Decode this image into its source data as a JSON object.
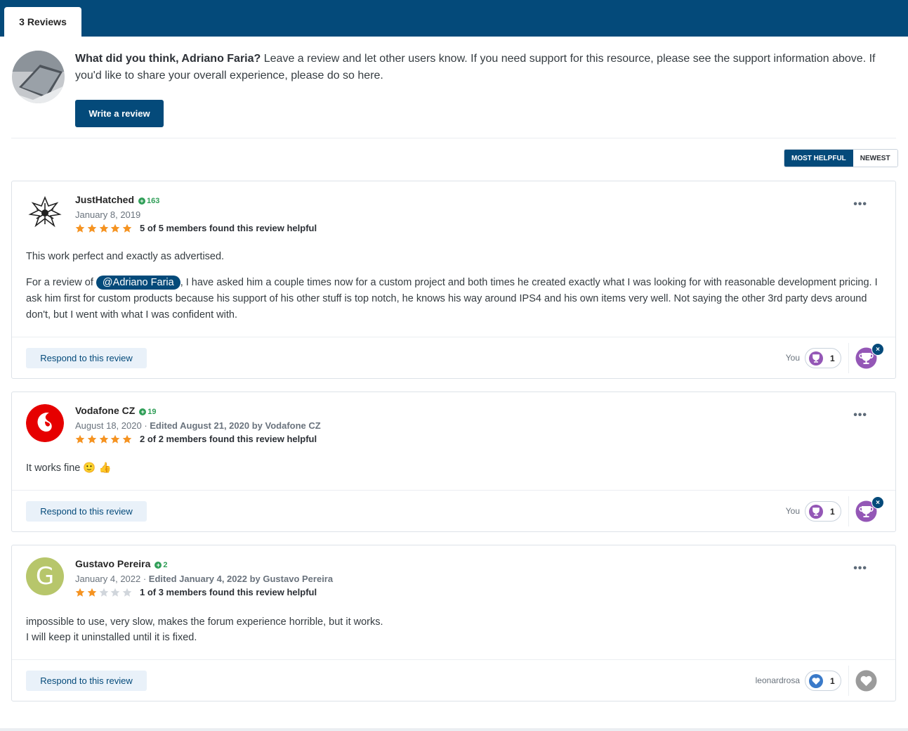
{
  "tabs": {
    "reviews_label": "3 Reviews"
  },
  "prompt": {
    "question": "What did you think, Adriano Faria?",
    "text": " Leave a review and let other users know. If you need support for this resource, please see the support information above. If you'd like to share your overall experience, please do so here.",
    "write_button": "Write a review"
  },
  "sort": {
    "most_helpful": "Most Helpful",
    "newest": "Newest"
  },
  "colors": {
    "brand": "#044a7a",
    "star": "#f59321",
    "rep": "#2f9e57",
    "trophy": "#9457b6",
    "like": "#3a7ac9"
  },
  "reviews": [
    {
      "author": "JustHatched",
      "rep": "163",
      "date": "January 8, 2019",
      "edited": "",
      "rating": 5,
      "helpful": "5 of 5 members found this review helpful",
      "paragraph1": "This work perfect and exactly as advertised.",
      "para2_prefix": "For a review of ",
      "mention": "@Adriano Faria",
      "para2_suffix": ", I have asked him a couple times now for a custom project and both times he created exactly what I was looking for with reasonable development pricing. I ask him first for custom products because his support of his other stuff is top notch, he knows his way around IPS4 and his own items very well. Not saying the other 3rd party devs around don't, but I went with what I was confident with.",
      "respond": "Respond to this review",
      "reacted_by": "You",
      "reaction_count": "1",
      "reaction_icon": "trophy-icon"
    },
    {
      "author": "Vodafone CZ",
      "rep": "19",
      "date": "August 18, 2020",
      "edited": "Edited August 21, 2020 by Vodafone CZ",
      "rating": 5,
      "helpful": "2 of 2 members found this review helpful",
      "paragraph1": "It works fine 🙂 👍",
      "respond": "Respond to this review",
      "reacted_by": "You",
      "reaction_count": "1",
      "reaction_icon": "trophy-icon"
    },
    {
      "author": "Gustavo Pereira",
      "rep": "2",
      "date": "January 4, 2022",
      "edited": "Edited January 4, 2022 by Gustavo Pereira",
      "rating": 2,
      "helpful": "1 of 3 members found this review helpful",
      "avatar_letter": "G",
      "line1": "impossible to use, very slow, makes the forum experience horrible, but it works.",
      "line2": "I will keep it uninstalled until it is fixed.",
      "respond": "Respond to this review",
      "reacted_by": "leonardrosa",
      "reaction_count": "1",
      "reaction_icon": "heart-icon"
    }
  ]
}
